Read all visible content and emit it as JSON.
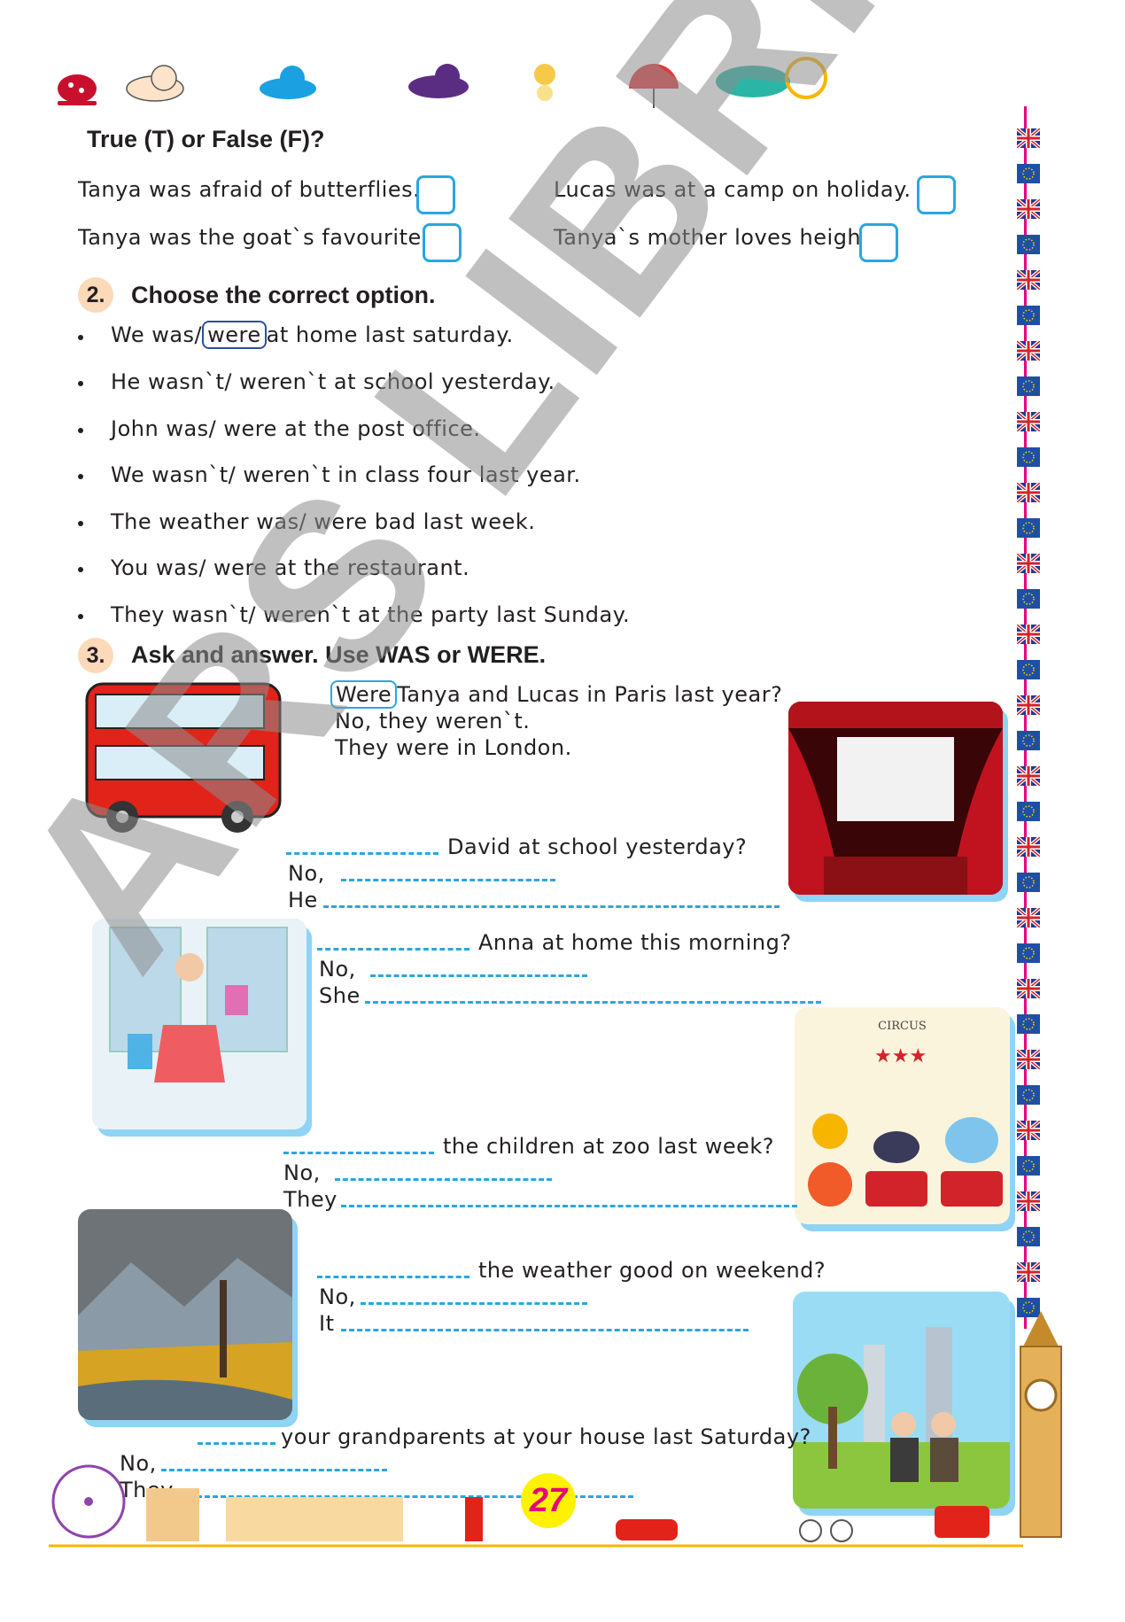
{
  "ex1": {
    "title": "True (T) or False (F)?",
    "items": [
      "Tanya was afraid of butterflies.",
      "Lucas was at a camp on holiday.",
      "Tanya was the goat`s favourite.",
      "Tanya`s mother loves height."
    ]
  },
  "ex2": {
    "number": "2.",
    "title": "Choose the correct option.",
    "example": {
      "before": "We was/",
      "circled": "were",
      "after": "at home last saturday."
    },
    "items": [
      "He wasn`t/ weren`t at school yesterday.",
      "John was/ were at the post office.",
      "We wasn`t/ weren`t in class four last year.",
      "The weather was/ were bad last week.",
      "You was/ were at the restaurant.",
      "They wasn`t/ weren`t at the party last Sunday."
    ]
  },
  "ex3": {
    "number": "3.",
    "title": "Ask and answer. Use WAS or WERE.",
    "example": {
      "circled": "Were",
      "question": "Tanya and Lucas in Paris last year?",
      "answer1": "No, they weren`t.",
      "answer2": "They were in London."
    },
    "q1": {
      "question": "David at school yesterday?",
      "no": "No,",
      "subject": "He"
    },
    "q2": {
      "question": "Anna at home this morning?",
      "no": "No,",
      "subject": "She"
    },
    "q3": {
      "question": "the children at zoo last week?",
      "no": "No,",
      "subject": "They"
    },
    "q4": {
      "question": "the weather good on weekend?",
      "no": "No,",
      "subject": "It"
    },
    "q5": {
      "question": "your grandparents at your house last Saturday?",
      "no": "No,",
      "subject": "They"
    },
    "circus_sign": "CIRCUS"
  },
  "watermark": "ARS LIBRI",
  "page_number": "27",
  "colors": {
    "accent_blue": "#2aa6e0",
    "circle_blue": "#2b4fa3",
    "number_bg": "#fbd9b9",
    "page_badge": "#fff200"
  }
}
